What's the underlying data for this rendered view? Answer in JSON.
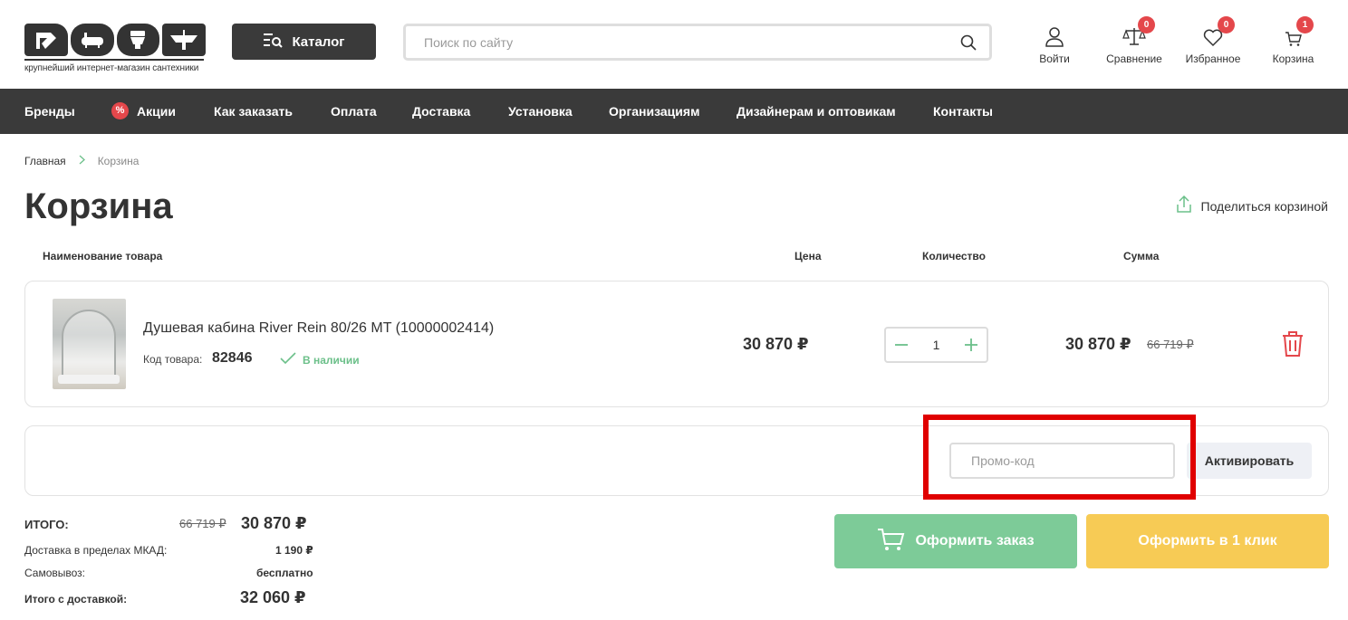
{
  "header": {
    "logo_tagline": "крупнейший интернет-магазин сантехники",
    "catalog_label": "Каталог",
    "search_placeholder": "Поиск по сайту",
    "login_label": "Войти",
    "compare_label": "Сравнение",
    "compare_count": "0",
    "favorites_label": "Избранное",
    "favorites_count": "0",
    "cart_label": "Корзина",
    "cart_count": "1",
    "badge_color": "#e4474b"
  },
  "nav": {
    "items": [
      "Бренды",
      "Акции",
      "Как заказать",
      "Оплата",
      "Доставка",
      "Установка",
      "Организациям",
      "Дизайнерам и оптовикам",
      "Контакты"
    ]
  },
  "breadcrumb": {
    "home": "Главная",
    "current": "Корзина"
  },
  "page": {
    "title": "Корзина",
    "share_label": "Поделиться корзиной"
  },
  "table": {
    "headers": {
      "name": "Наименование товара",
      "price": "Цена",
      "qty": "Количество",
      "sum": "Сумма"
    }
  },
  "product": {
    "name": "Душевая кабина River Rein 80/26 MT (10000002414)",
    "code_label": "Код товара:",
    "code": "82846",
    "stock": "В наличии",
    "price": "30 870 ₽",
    "quantity": "1",
    "sum": "30 870 ₽",
    "sum_old": "66 719 ₽"
  },
  "promo": {
    "placeholder": "Промо-код",
    "activate_label": "Активировать"
  },
  "totals": {
    "total_label": "ИТОГО:",
    "total_old": "66 719 ₽",
    "total": "30 870 ₽",
    "delivery_label": "Доставка в пределах МКАД:",
    "delivery_value": "1 190 ₽",
    "pickup_label": "Самовывоз:",
    "pickup_value": "бесплатно",
    "with_delivery_label": "Итого с доставкой:",
    "with_delivery_value": "32 060 ₽"
  },
  "actions": {
    "order_label": "Оформить заказ",
    "order_color": "#7dcb98",
    "one_click_label": "Оформить в 1 клик",
    "one_click_color": "#f7cb55"
  }
}
